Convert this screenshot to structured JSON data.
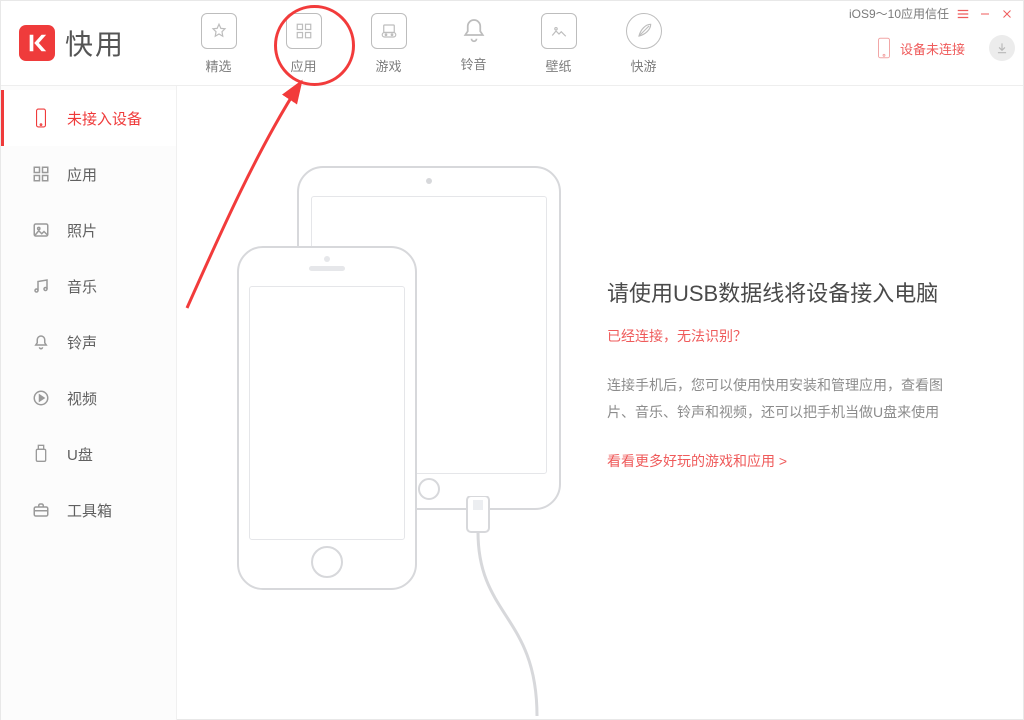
{
  "brand": {
    "name": "快用"
  },
  "tabs": [
    {
      "key": "featured",
      "label": "精选"
    },
    {
      "key": "apps",
      "label": "应用"
    },
    {
      "key": "games",
      "label": "游戏"
    },
    {
      "key": "ringtones",
      "label": "铃音"
    },
    {
      "key": "wallpapers",
      "label": "壁纸"
    },
    {
      "key": "quickplay",
      "label": "快游"
    }
  ],
  "top_right": {
    "trust_text": "iOS9～10应用信任",
    "device_status": "设备未连接"
  },
  "sidebar": [
    {
      "key": "no-device",
      "label": "未接入设备",
      "active": true
    },
    {
      "key": "apps",
      "label": "应用"
    },
    {
      "key": "photos",
      "label": "照片"
    },
    {
      "key": "music",
      "label": "音乐"
    },
    {
      "key": "ringtones",
      "label": "铃声"
    },
    {
      "key": "videos",
      "label": "视频"
    },
    {
      "key": "udisk",
      "label": "U盘"
    },
    {
      "key": "toolbox",
      "label": "工具箱"
    }
  ],
  "content": {
    "heading": "请使用USB数据线将设备接入电脑",
    "already_link": "已经连接，无法识别？",
    "description": "连接手机后，您可以使用快用安装和管理应用，查看图片、音乐、铃声和视频，还可以把手机当做U盘来使用",
    "more_link": "看看更多好玩的游戏和应用 >"
  }
}
